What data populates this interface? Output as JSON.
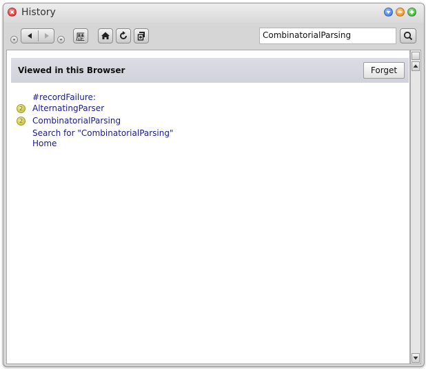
{
  "window": {
    "title": "History"
  },
  "icons": {
    "close": "close-icon",
    "menu": "window-menu-icon",
    "minimize": "minimize-icon",
    "maximize": "maximize-icon",
    "back": "back-arrow-icon",
    "forward": "forward-arrow-icon",
    "history": "history-icon",
    "home": "home-icon",
    "refresh": "refresh-icon",
    "new_page": "new-page-icon",
    "search": "search-icon"
  },
  "toolbar": {
    "history_button_glyph": "歷"
  },
  "search": {
    "value": "CombinatorialParsing"
  },
  "panel": {
    "header_title": "Viewed in this Browser",
    "forget_label": "Forget"
  },
  "history_items": [
    {
      "badge": "",
      "label": "#recordFailure:"
    },
    {
      "badge": "2",
      "label": "AlternatingParser"
    },
    {
      "badge": "2",
      "label": "CombinatorialParsing"
    },
    {
      "badge": "",
      "label": "Search for \"CombinatorialParsing\""
    },
    {
      "badge": "",
      "label": "Home"
    }
  ],
  "colors": {
    "link": "#1a1a8c",
    "header_bg": "#d6d6e0",
    "window_bg": "#d6d6d6"
  }
}
